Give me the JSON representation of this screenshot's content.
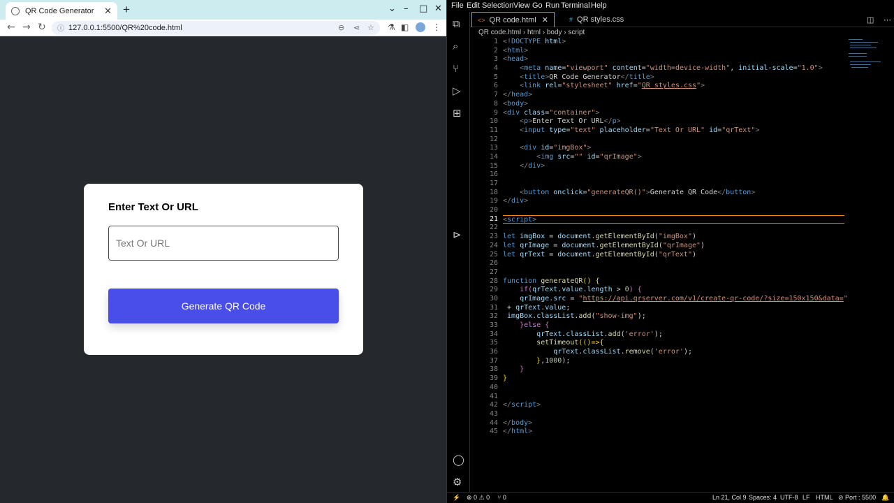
{
  "browser": {
    "tab_title": "QR Code Generator",
    "tab_close": "✕",
    "new_tab": "+",
    "url": "127.0.0.1:5500/QR%20code.html",
    "page": {
      "label": "Enter Text Or URL",
      "input_placeholder": "Text Or URL",
      "input_value": "",
      "button_label": "Generate QR Code"
    }
  },
  "vscode": {
    "menu": [
      "File",
      "Edit",
      "Selection",
      "View",
      "Go",
      "Run",
      "Terminal",
      "Help"
    ],
    "tabs": [
      {
        "label": "QR code.html",
        "icon": "html-file-icon",
        "active": true
      },
      {
        "label": "QR styles.css",
        "icon": "css-file-icon",
        "active": false
      }
    ],
    "breadcrumb": [
      "QR code.html",
      "html",
      "body",
      "script"
    ],
    "line_numbers": [
      "1",
      "2",
      "3",
      "4",
      "5",
      "6",
      "7",
      "8",
      "9",
      "10",
      "11",
      "12",
      "13",
      "14",
      "15",
      "16",
      "17",
      "18",
      "19",
      "20",
      "21",
      "22",
      "23",
      "24",
      "25",
      "26",
      "27",
      "28",
      "29",
      "30",
      "31",
      "32",
      "33",
      "34",
      "35",
      "36",
      "37",
      "38",
      "39",
      "40",
      "41",
      "42",
      "43",
      "44",
      "45"
    ],
    "current_line": 21,
    "status": {
      "errors": "0",
      "warnings": "0",
      "ports": "0",
      "position": "Ln 21, Col 9",
      "spaces": "Spaces: 4",
      "encoding": "UTF-8",
      "eol": "LF",
      "language": "HTML",
      "port": "Port : 5500"
    },
    "colors": {
      "accent": "#f38518",
      "button": "#494eea"
    }
  }
}
